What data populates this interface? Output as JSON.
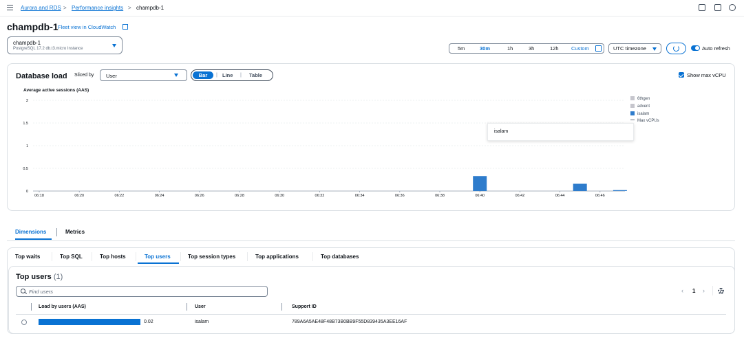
{
  "breadcrumb": {
    "items": [
      "Aurora and RDS",
      "Performance insights",
      "champdb-1"
    ],
    "separator": ">"
  },
  "header": {
    "title": "champdb-1",
    "fleet_link": "Fleet view in CloudWatch"
  },
  "instance_selector": {
    "name": "champdb-1",
    "meta": "PostgreSQL   17.2   db.t3.micro   Instance"
  },
  "time_range": {
    "options": [
      "5m",
      "30m",
      "1h",
      "3h",
      "12h",
      "Custom"
    ],
    "selected": "30m"
  },
  "timezone": "UTC timezone",
  "auto_refresh": {
    "label": "Auto refresh",
    "enabled": true
  },
  "db_load": {
    "title": "Database load",
    "sliced_by_label": "Sliced by",
    "sliced_by_value": "User",
    "view_modes": [
      "Bar",
      "Line",
      "Table"
    ],
    "selected_view": "Bar",
    "show_max_vcpu_label": "Show max vCPU",
    "show_max_vcpu_checked": true,
    "tooltip": "isalam"
  },
  "chart_data": {
    "type": "bar",
    "ylabel": "Average active sessions (AAS)",
    "ylim": [
      0,
      2
    ],
    "y_ticks": [
      "0",
      "0.5",
      "1",
      "1.5",
      "2"
    ],
    "x_tick_labels": [
      "06:18",
      "06:20",
      "06:22",
      "06:24",
      "06:26",
      "06:28",
      "06:30",
      "06:32",
      "06:34",
      "06:36",
      "06:38",
      "06:40",
      "06:42",
      "06:44",
      "06:46"
    ],
    "legend": [
      "6thgen",
      "advent",
      "isalam",
      "Max vCPUs"
    ],
    "series": [
      {
        "name": "isalam",
        "color": "#2e7ccc",
        "points": [
          {
            "time": "06:40",
            "value": 0.33
          },
          {
            "time": "06:45",
            "value": 0.16
          },
          {
            "time": "06:47",
            "value": 0.02
          }
        ]
      }
    ],
    "grid": true
  },
  "colors": {
    "accent": "#0972d3",
    "bar": "#2e7ccc",
    "legend_gray": "#c6c6cd"
  },
  "dimension_tabs": {
    "items": [
      "Dimensions",
      "Metrics"
    ],
    "selected": "Dimensions"
  },
  "top_tabs": {
    "items": [
      "Top waits",
      "Top SQL",
      "Top hosts",
      "Top users",
      "Top session types",
      "Top applications",
      "Top databases"
    ],
    "selected": "Top users"
  },
  "top_users": {
    "title": "Top users",
    "count": "(1)",
    "search_placeholder": "Find users",
    "page": "1",
    "columns": [
      "Load by users (AAS)",
      "User",
      "Support ID"
    ],
    "rows": [
      {
        "load": "0.02",
        "load_fraction": 1.0,
        "user": "isalam",
        "support_id": "789A6A5AE48F48B73B0BB9F55D839435A3EE16AF"
      }
    ]
  }
}
